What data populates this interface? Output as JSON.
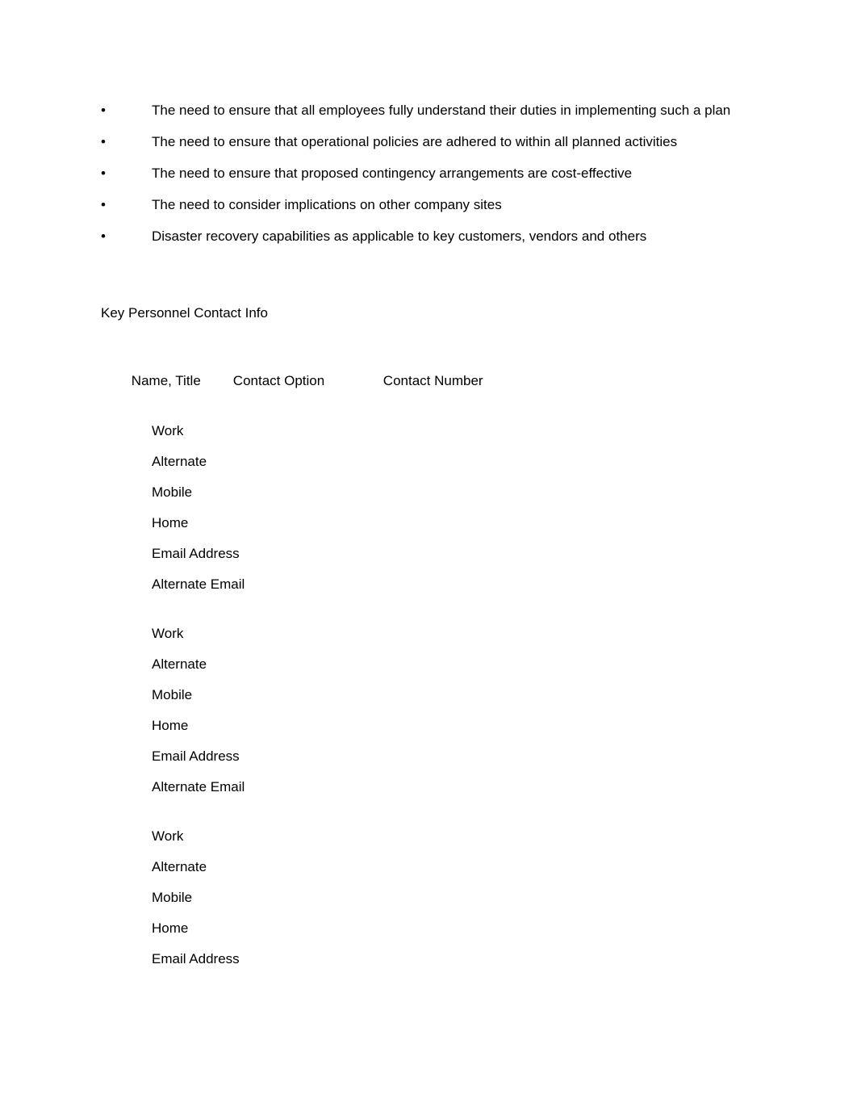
{
  "document": {
    "page_background": "#ffffff",
    "text_color": "#000000",
    "bullet_glyph": "•"
  },
  "bullets": [
    {
      "marker": "•",
      "text": "The need to ensure that all employees fully understand their duties in implementing such a plan"
    },
    {
      "marker": "•",
      "text": "The need to ensure that operational policies are adhered to within all planned activities"
    },
    {
      "marker": "•",
      "text": "The need to ensure that proposed contingency arrangements are cost-effective"
    },
    {
      "marker": "•",
      "text": "The need to consider implications on other company sites"
    },
    {
      "marker": "•",
      "text": "Disaster recovery capabilities as applicable to key customers, vendors and others"
    }
  ],
  "contact_section": {
    "heading": "Key Personnel Contact Info",
    "columns": {
      "name_title": "Name, Title",
      "contact_option": "Contact Option",
      "contact_number": "Contact Number"
    },
    "blocks": [
      {
        "rows": [
          {
            "option": "Work",
            "number": ""
          },
          {
            "option": "Alternate",
            "number": ""
          },
          {
            "option": "Mobile",
            "number": ""
          },
          {
            "option": "Home",
            "number": ""
          },
          {
            "option": "Email Address",
            "number": ""
          },
          {
            "option": "Alternate Email",
            "number": ""
          }
        ]
      },
      {
        "rows": [
          {
            "option": "Work",
            "number": ""
          },
          {
            "option": "Alternate",
            "number": ""
          },
          {
            "option": "Mobile",
            "number": ""
          },
          {
            "option": "Home",
            "number": ""
          },
          {
            "option": "Email Address",
            "number": ""
          },
          {
            "option": "Alternate Email",
            "number": ""
          }
        ]
      },
      {
        "rows": [
          {
            "option": "Work",
            "number": ""
          },
          {
            "option": "Alternate",
            "number": ""
          },
          {
            "option": "Mobile",
            "number": ""
          },
          {
            "option": "Home",
            "number": ""
          },
          {
            "option": "Email Address",
            "number": ""
          }
        ]
      }
    ]
  }
}
